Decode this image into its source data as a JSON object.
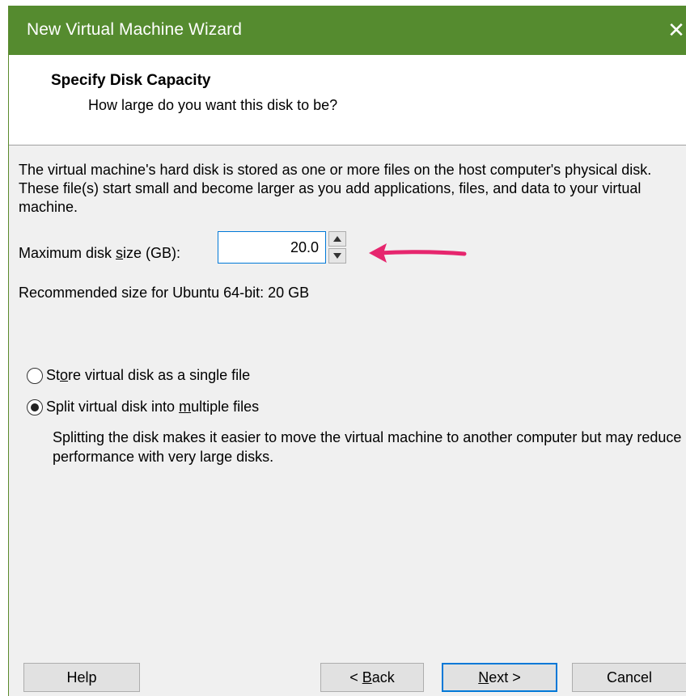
{
  "window": {
    "title": "New Virtual Machine Wizard",
    "close_glyph": "✕",
    "colors": {
      "titlebar": "#558b2f",
      "focus": "#0078d7",
      "annotation_arrow": "#e6266e"
    }
  },
  "header": {
    "title": "Specify Disk Capacity",
    "subtitle": "How large do you want this disk to be?"
  },
  "content": {
    "description": "The virtual machine's hard disk is stored as one or more files on the host computer's physical disk. These file(s) start small and become larger as you add applications, files, and data to your virtual machine.",
    "max_size_label_pre": "Maximum disk ",
    "max_size_label_u": "s",
    "max_size_label_post": "ize (GB):",
    "max_size_value": "20.0",
    "recommended": "Recommended size for Ubuntu 64-bit: 20 GB",
    "radio_single_pre": "St",
    "radio_single_u": "o",
    "radio_single_post": "re virtual disk as a single file",
    "radio_split_pre": "Split virtual disk into ",
    "radio_split_u": "m",
    "radio_split_post": "ultiple files",
    "selected_option": "split",
    "split_note": "Splitting the disk makes it easier to move the virtual machine to another computer but may reduce performance with very large disks."
  },
  "footer": {
    "help": "Help",
    "back_pre": "< ",
    "back_u": "B",
    "back_post": "ack",
    "next_u": "N",
    "next_post": "ext >",
    "cancel": "Cancel"
  },
  "icons": {
    "close": "close-icon",
    "spin_up": "spin-up-icon",
    "spin_down": "spin-down-icon",
    "annotation": "arrow-left-annotation-icon"
  }
}
